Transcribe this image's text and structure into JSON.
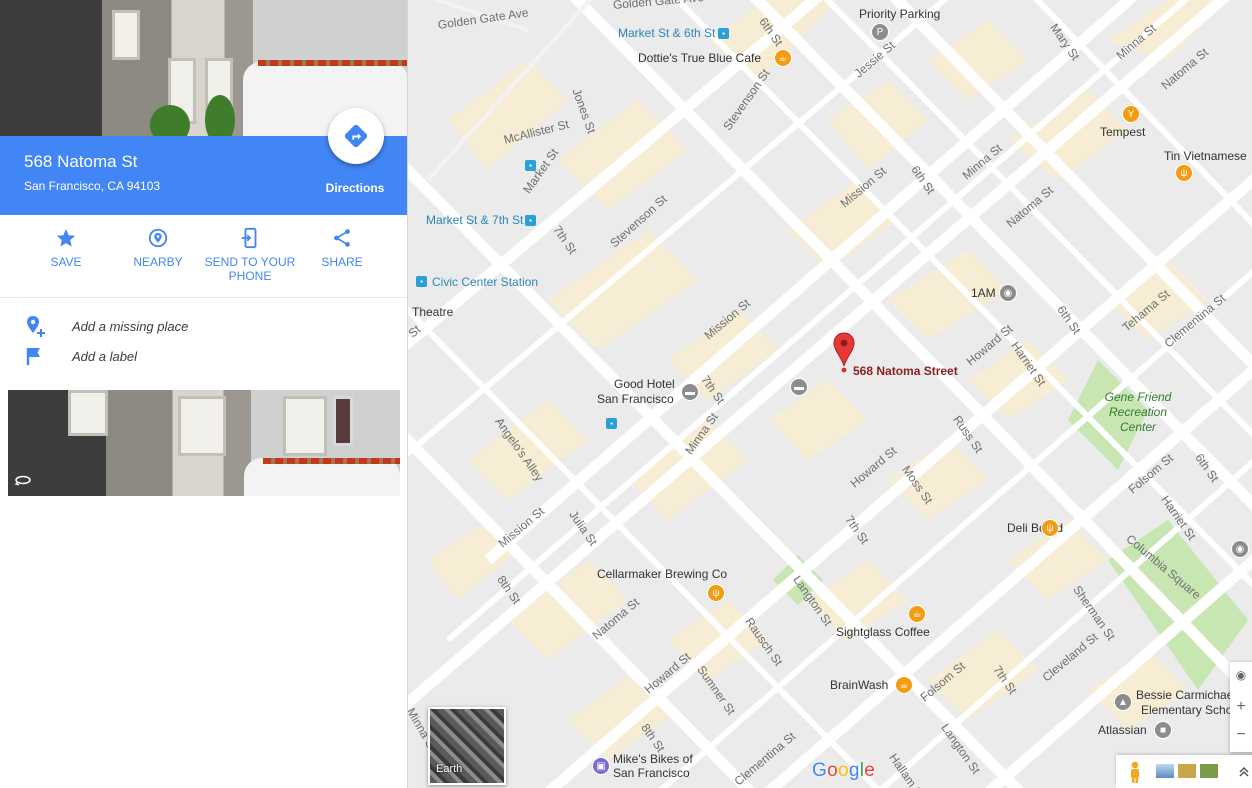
{
  "place": {
    "title": "568 Natoma St",
    "address": "San Francisco, CA 94103",
    "directions_label": "Directions"
  },
  "actions": [
    {
      "label": "SAVE",
      "icon": "star-icon"
    },
    {
      "label": "NEARBY",
      "icon": "nearby-pin-icon"
    },
    {
      "label": "SEND TO YOUR",
      "label2": "PHONE",
      "icon": "send-to-phone-icon"
    },
    {
      "label": "SHARE",
      "icon": "share-icon"
    }
  ],
  "suggest": {
    "add_missing_place": "Add a missing place",
    "add_label": "Add a label"
  },
  "colors": {
    "accent": "#4285f4",
    "pin": "#e53935",
    "food": "#f39c12",
    "hotel_poi": "#8c8c8c",
    "transit": "#2a9fd8",
    "park": "#c8e6b2"
  },
  "map": {
    "pin_label": "568 Natoma Street",
    "streets": [
      "Golden Gate Ave",
      "Golden Gate Ave",
      "6th St",
      "Jones St",
      "McAllister St",
      "Market St",
      "Stevenson St",
      "Jessie St",
      "Mission St",
      "6th St",
      "Minna St",
      "Natoma St",
      "Mary St",
      "Minna St",
      "Natoma St",
      "7th St",
      "Stevenson St",
      "Mission St",
      "7th St",
      "Howard St",
      "Tehama St",
      "Clementina St",
      "6th St",
      "Harriet St",
      "Russ St",
      "Angelo's Alley",
      "Minna St",
      "Howard St",
      "Moss St",
      "Folsom St",
      "6th St",
      "Harriet St",
      "Mission St",
      "Julia St",
      "7th St",
      "Columbia Square",
      "8th St",
      "Natoma St",
      "Langton St",
      "Sherman St",
      "Rausch St",
      "Howard St",
      "Sumner St",
      "Folsom St",
      "7th St",
      "Cleveland St",
      "Langton St",
      "8th St",
      "Clementina St",
      "Hallam St",
      "Minna St",
      "St"
    ],
    "transit": [
      {
        "label": "Market St & 6th St"
      },
      {
        "label": "Market St & 7th St"
      },
      {
        "label": "Civic Center Station"
      }
    ],
    "pois": [
      {
        "name": "Priority Parking",
        "icon": "parking-icon"
      },
      {
        "name": "Dottie's True Blue Cafe",
        "icon": "cafe-icon"
      },
      {
        "name": "Tempest",
        "icon": "bar-icon"
      },
      {
        "name": "Tin Vietnamese",
        "icon": "restaurant-icon"
      },
      {
        "name": "1AM",
        "icon": "art-gallery-icon"
      },
      {
        "name": "Theatre",
        "icon": "theatre-icon"
      },
      {
        "name": "Good Hotel",
        "name2": "San Francisco",
        "icon": "hotel-icon"
      },
      {
        "name": "Deli Board",
        "icon": "restaurant-icon"
      },
      {
        "name": "Cellarmaker Brewing Co",
        "icon": "restaurant-icon"
      },
      {
        "name": "Sightglass Coffee",
        "icon": "cafe-icon"
      },
      {
        "name": "BrainWash",
        "icon": "cafe-icon"
      },
      {
        "name": "Bessie Carmichael",
        "name2": "Elementary Scho",
        "icon": "school-icon"
      },
      {
        "name": "Atlassian",
        "icon": "office-icon"
      },
      {
        "name": "Mike's Bikes of",
        "name2": "San Francisco",
        "icon": "bike-shop-icon"
      }
    ],
    "park": {
      "line1": "Gene Friend",
      "line2": "Recreation",
      "line3": "Center"
    },
    "earth_label": "Earth",
    "logo": "Google"
  }
}
